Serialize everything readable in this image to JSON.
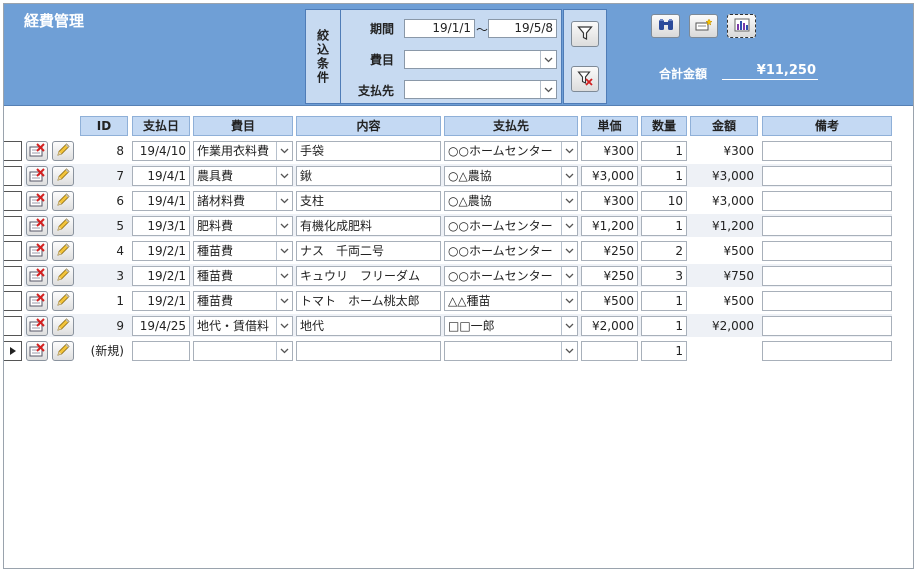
{
  "app": {
    "title": "経費管理"
  },
  "filter": {
    "section_label": "絞込条件",
    "period_label": "期間",
    "period_from": "19/1/1",
    "period_sep": "〜",
    "period_to": "19/5/8",
    "category_label": "費目",
    "category_value": "",
    "payee_label": "支払先",
    "payee_value": ""
  },
  "summary": {
    "total_label": "合計金額",
    "total_value": "¥11,250"
  },
  "columns": {
    "id": "ID",
    "date": "支払日",
    "category": "費目",
    "content": "内容",
    "payee": "支払先",
    "unit_price": "単価",
    "qty": "数量",
    "amount": "金額",
    "memo": "備考"
  },
  "rows": [
    {
      "id": "8",
      "date": "19/4/10",
      "category": "作業用衣料費",
      "content": "手袋",
      "payee": "○○ホームセンター",
      "unit_price": "¥300",
      "qty": "1",
      "amount": "¥300",
      "memo": ""
    },
    {
      "id": "7",
      "date": "19/4/1",
      "category": "農具費",
      "content": "鍬",
      "payee": "○△農協",
      "unit_price": "¥3,000",
      "qty": "1",
      "amount": "¥3,000",
      "memo": ""
    },
    {
      "id": "6",
      "date": "19/4/1",
      "category": "諸材料費",
      "content": "支柱",
      "payee": "○△農協",
      "unit_price": "¥300",
      "qty": "10",
      "amount": "¥3,000",
      "memo": ""
    },
    {
      "id": "5",
      "date": "19/3/1",
      "category": "肥料費",
      "content": "有機化成肥料",
      "payee": "○○ホームセンター",
      "unit_price": "¥1,200",
      "qty": "1",
      "amount": "¥1,200",
      "memo": ""
    },
    {
      "id": "4",
      "date": "19/2/1",
      "category": "種苗費",
      "content": "ナス　千両二号",
      "payee": "○○ホームセンター",
      "unit_price": "¥250",
      "qty": "2",
      "amount": "¥500",
      "memo": ""
    },
    {
      "id": "3",
      "date": "19/2/1",
      "category": "種苗費",
      "content": "キュウリ　フリーダム",
      "payee": "○○ホームセンター",
      "unit_price": "¥250",
      "qty": "3",
      "amount": "¥750",
      "memo": ""
    },
    {
      "id": "1",
      "date": "19/2/1",
      "category": "種苗費",
      "content": "トマト　ホーム桃太郎",
      "payee": "△△種苗",
      "unit_price": "¥500",
      "qty": "1",
      "amount": "¥500",
      "memo": ""
    },
    {
      "id": "9",
      "date": "19/4/25",
      "category": "地代・賃借料",
      "content": "地代",
      "payee": "□□一郎",
      "unit_price": "¥2,000",
      "qty": "1",
      "amount": "¥2,000",
      "memo": ""
    }
  ],
  "new_row": {
    "id": "(新規)",
    "date": "",
    "category": "",
    "content": "",
    "payee": "",
    "unit_price": "",
    "qty": "1",
    "amount": "",
    "memo": ""
  },
  "icons": {
    "filter_apply": "filter-icon",
    "filter_clear": "filter-clear-icon",
    "search": "binoculars-icon",
    "new_record": "new-record-icon",
    "report": "bar-chart-icon",
    "row_delete": "delete-record-icon",
    "row_edit": "pencil-icon"
  },
  "colors": {
    "header_bg": "#6f9fd6",
    "filter_bg": "#c7daf1",
    "column_header_bg": "#c4d9f3",
    "alt_row_bg": "#eef1f6"
  }
}
